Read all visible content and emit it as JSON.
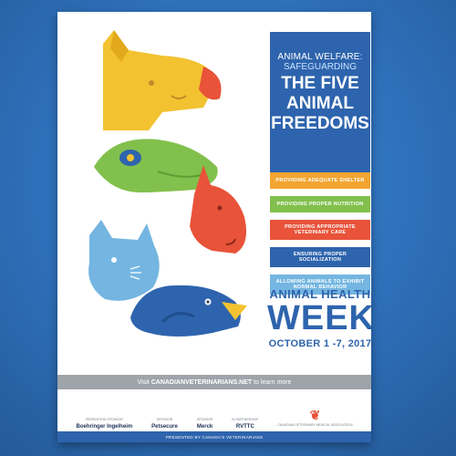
{
  "headline": {
    "line1": "ANIMAL WELFARE:",
    "line2": "SAFEGUARDING",
    "line3a": "THE FIVE",
    "line3b": "ANIMAL",
    "line3c": "FREEDOMS"
  },
  "freedoms": [
    {
      "label": "PROVIDING ADEQUATE SHELTER",
      "color": "#f2a531"
    },
    {
      "label": "PROVIDING PROPER NUTRITION",
      "color": "#82c04d"
    },
    {
      "label": "PROVIDING APPROPRIATE VETERINARY CARE",
      "color": "#e8533a"
    },
    {
      "label": "ENSURING PROPER SOCIALIZATION",
      "color": "#2e64ad"
    },
    {
      "label": "ALLOWING ANIMALS TO EXHIBIT NORMAL BEHAVIOR",
      "color": "#74b6e1"
    }
  ],
  "event": {
    "line1": "ANIMAL HEALTH",
    "line2": "WEEK",
    "dates": "OCTOBER 1 -7, 2017"
  },
  "visit": {
    "prefix": "Visit",
    "site": "CANADIANVETERINARIANS.NET",
    "suffix": "to learn more"
  },
  "sponsors": [
    {
      "caption": "Presenting sponsor",
      "name": "Boehringer Ingelheim"
    },
    {
      "caption": "Sponsor",
      "name": "Petsecure"
    },
    {
      "caption": "Sponsor",
      "name": "Merck"
    },
    {
      "caption": "In partnership",
      "name": "RVTTC"
    },
    {
      "caption": "",
      "name": "Canadian Veterinary Medical Association"
    }
  ],
  "footer": "PRESENTED BY CANADA'S VETERINARIANS",
  "colors": {
    "yellow": "#f2c230",
    "green": "#82c04d",
    "red": "#e8533a",
    "lightblue": "#74b6e1",
    "blue": "#2e64ad",
    "orange": "#f2a531"
  }
}
